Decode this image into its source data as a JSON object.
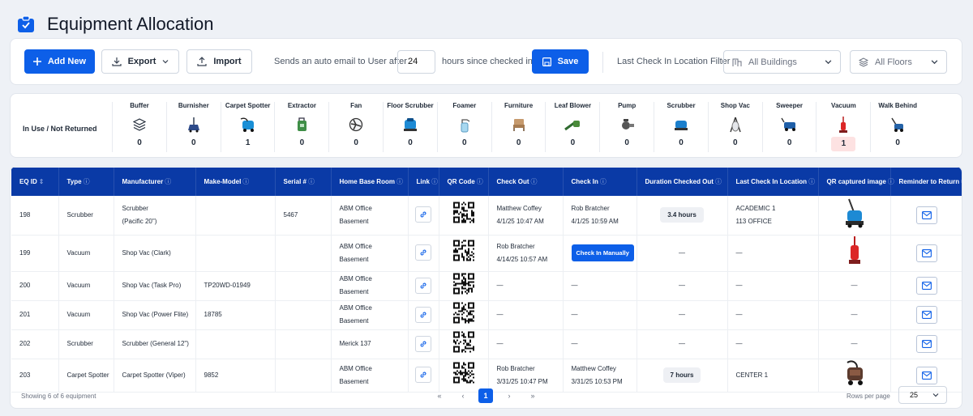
{
  "page": {
    "title": "Equipment Allocation"
  },
  "toolbar": {
    "add_new": "Add New",
    "export": "Export",
    "import": "Import",
    "email_prefix": "Sends an auto email to User after",
    "hours_value": "24",
    "email_suffix": "hours since checked in.",
    "save": "Save",
    "location_filter_label": "Last Check In Location Filter",
    "buildings": "All Buildings",
    "floors": "All Floors"
  },
  "in_use": {
    "label": "In Use / Not Returned",
    "categories": [
      {
        "name": "Buffer",
        "icon": "stack-icon",
        "count": "0"
      },
      {
        "name": "Burnisher",
        "icon": "burnisher-icon",
        "count": "0"
      },
      {
        "name": "Carpet Spotter",
        "icon": "carpet-spotter-icon",
        "count": "1"
      },
      {
        "name": "Extractor",
        "icon": "extractor-icon",
        "count": "0"
      },
      {
        "name": "Fan",
        "icon": "fan-icon",
        "count": "0"
      },
      {
        "name": "Floor Scrubber",
        "icon": "floor-scrubber-icon",
        "count": "0"
      },
      {
        "name": "Foamer",
        "icon": "spray-bottle-icon",
        "count": "0"
      },
      {
        "name": "Furniture",
        "icon": "chair-icon",
        "count": "0"
      },
      {
        "name": "Leaf Blower",
        "icon": "leaf-blower-icon",
        "count": "0"
      },
      {
        "name": "Pump",
        "icon": "pump-icon",
        "count": "0"
      },
      {
        "name": "Scrubber",
        "icon": "scrubber-icon",
        "count": "0"
      },
      {
        "name": "Shop Vac",
        "icon": "shop-vac-icon",
        "count": "0"
      },
      {
        "name": "Sweeper",
        "icon": "sweeper-icon",
        "count": "0"
      },
      {
        "name": "Vacuum",
        "icon": "vacuum-icon",
        "count": "1"
      },
      {
        "name": "Walk Behind",
        "icon": "walk-behind-icon",
        "count": "0"
      }
    ]
  },
  "table": {
    "headers": [
      "EQ ID",
      "Type",
      "Manufacturer",
      "Make-Model",
      "Serial #",
      "Home Base Room",
      "Link",
      "QR Code",
      "Check Out",
      "Check In",
      "Duration Checked Out",
      "Last Check In Location",
      "QR captured image",
      "Reminder to Return"
    ],
    "check_in_manually": "Check In Manually",
    "dash": "—",
    "rows": [
      {
        "eq_id": "198",
        "type": "Scrubber",
        "manufacturer_1": "Scrubber",
        "manufacturer_2": "(Pacific 20\")",
        "model": "",
        "serial": "5467",
        "room_1": "ABM Office",
        "room_2": "Basement",
        "out_1": "Matthew Coffey",
        "out_2": "4/1/25 10:47 AM",
        "in_1": "Rob Bratcher",
        "in_2": "4/1/25 10:59 AM",
        "duration": "3.4 hours",
        "loc_1": "ACADEMIC 1",
        "loc_2": "113 OFFICE",
        "image": "scrubber-image"
      },
      {
        "eq_id": "199",
        "type": "Vacuum",
        "manufacturer_1": "Shop Vac (Clark)",
        "manufacturer_2": "",
        "model": "",
        "serial": "",
        "room_1": "ABM Office",
        "room_2": "Basement",
        "out_1": "Rob Bratcher",
        "out_2": "4/14/25 10:57 AM",
        "in_1": "",
        "in_2": "",
        "duration": "—",
        "loc_1": "—",
        "loc_2": "",
        "image": "vacuum-image"
      },
      {
        "eq_id": "200",
        "type": "Vacuum",
        "manufacturer_1": "Shop Vac (Task Pro)",
        "manufacturer_2": "",
        "model": "TP20WD-01949",
        "serial": "",
        "room_1": "ABM Office",
        "room_2": "Basement",
        "out_1": "—",
        "out_2": "",
        "in_1": "—",
        "in_2": "",
        "duration": "—",
        "loc_1": "—",
        "loc_2": "",
        "image": ""
      },
      {
        "eq_id": "201",
        "type": "Vacuum",
        "manufacturer_1": "Shop Vac (Power Flite)",
        "manufacturer_2": "",
        "model": "18785",
        "serial": "",
        "room_1": "ABM Office",
        "room_2": "Basement",
        "out_1": "—",
        "out_2": "",
        "in_1": "—",
        "in_2": "",
        "duration": "—",
        "loc_1": "—",
        "loc_2": "",
        "image": ""
      },
      {
        "eq_id": "202",
        "type": "Scrubber",
        "manufacturer_1": "Scrubber (General 12\")",
        "manufacturer_2": "",
        "model": "",
        "serial": "",
        "room_1": "Merick 137",
        "room_2": "",
        "out_1": "—",
        "out_2": "",
        "in_1": "—",
        "in_2": "",
        "duration": "—",
        "loc_1": "—",
        "loc_2": "",
        "image": ""
      },
      {
        "eq_id": "203",
        "type": "Carpet Spotter",
        "manufacturer_1": "Carpet Spotter (Viper)",
        "manufacturer_2": "",
        "model": "9852",
        "serial": "",
        "room_1": "ABM Office",
        "room_2": "Basement",
        "out_1": "Rob Bratcher",
        "out_2": "3/31/25 10:47 PM",
        "in_1": "Matthew Coffey",
        "in_2": "3/31/25 10:53 PM",
        "duration": "7 hours",
        "loc_1": "CENTER 1",
        "loc_2": "",
        "image": "carpet-spotter-image"
      }
    ]
  },
  "footer": {
    "showing": "Showing 6 of 6 equipment",
    "current_page": "1",
    "rows_per_page_label": "Rows per page",
    "rows_per_page": "25"
  },
  "colors": {
    "primary": "#0d5fe8",
    "header": "#0a3aa6",
    "highlight": "#fde2e2"
  }
}
